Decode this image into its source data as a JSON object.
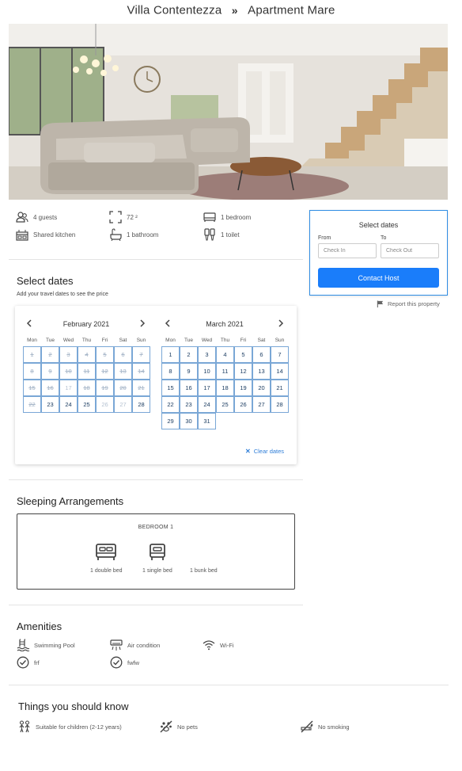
{
  "breadcrumb": {
    "parent": "Villa Contentezza",
    "separator": "»",
    "current": "Apartment Mare"
  },
  "features": [
    {
      "icon": "guests-icon",
      "label": "4 guests"
    },
    {
      "icon": "area-icon",
      "label": "72 ²"
    },
    {
      "icon": "bedroom-icon",
      "label": "1 bedroom"
    },
    {
      "icon": "kitchen-icon",
      "label": "Shared kitchen"
    },
    {
      "icon": "bathroom-icon",
      "label": "1 bathroom"
    },
    {
      "icon": "toilet-icon",
      "label": "1 toilet"
    }
  ],
  "booking": {
    "title": "Select dates",
    "from_label": "From",
    "to_label": "To",
    "checkin_placeholder": "Check In",
    "checkout_placeholder": "Check Out",
    "contact_label": "Contact Host"
  },
  "report_label": "Report this property",
  "select_dates": {
    "title": "Select dates",
    "subtitle": "Add your travel dates to see the price"
  },
  "calendar": {
    "weekdays": [
      "Mon",
      "Tue",
      "Wed",
      "Thu",
      "Fri",
      "Sat",
      "Sun"
    ],
    "months": [
      {
        "name": "February 2021",
        "first_weekday": 0,
        "days": 28,
        "past_until": 22,
        "dim_days": [
          17,
          26,
          27
        ]
      },
      {
        "name": "March 2021",
        "first_weekday": 0,
        "days": 31,
        "past_until": 0,
        "dim_days": []
      }
    ],
    "clear_label": "Clear dates"
  },
  "sleeping": {
    "title": "Sleeping Arrangements",
    "bedroom_title": "BEDROOM 1",
    "beds": [
      {
        "icon": "double-bed-icon",
        "label": "1 double bed"
      },
      {
        "icon": "single-bed-icon",
        "label": "1 single bed"
      },
      {
        "icon": "bunk-bed-icon",
        "label": "1 bunk bed"
      }
    ]
  },
  "amenities": {
    "title": "Amenities",
    "items": [
      {
        "icon": "pool-icon",
        "label": "Swimming Pool"
      },
      {
        "icon": "air-condition-icon",
        "label": "Air condition"
      },
      {
        "icon": "wifi-icon",
        "label": "Wi-Fi"
      },
      {
        "icon": "check-icon",
        "label": "frf"
      },
      {
        "icon": "check-icon",
        "label": "fwfw"
      }
    ]
  },
  "rules": {
    "title": "Things you should know",
    "items": [
      {
        "icon": "children-icon",
        "label": "Suitable for children (2-12 years)"
      },
      {
        "icon": "no-pets-icon",
        "label": "No pets"
      },
      {
        "icon": "no-smoking-icon",
        "label": "No smoking"
      }
    ]
  },
  "colors": {
    "accent": "#1a7dfa",
    "calendar_border": "#7aa7d6",
    "link": "#2f7ed8"
  }
}
